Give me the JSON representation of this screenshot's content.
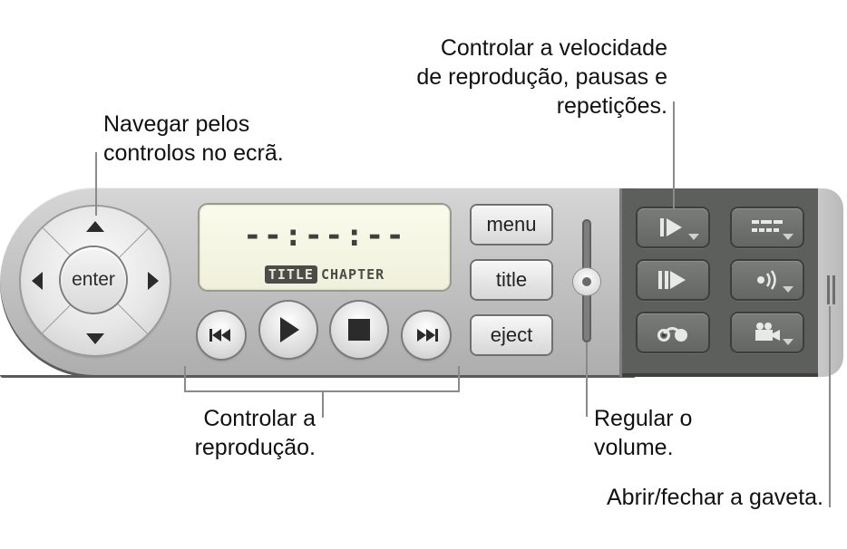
{
  "callouts": {
    "navigate": [
      "Navegar pelos",
      "controlos no ecrã."
    ],
    "speed": [
      "Controlar a velocidade",
      "de reprodução, pausas e",
      "repetições."
    ],
    "playback": [
      "Controlar a",
      "reprodução."
    ],
    "volume": [
      "Regular o",
      "volume."
    ],
    "drawer": [
      "Abrir/fechar a gaveta."
    ]
  },
  "controller": {
    "dpad": {
      "enter_label": "enter"
    },
    "lcd": {
      "time": "--:--:--",
      "tag_title": "TITLE",
      "tag_chapter": "CHAPTER"
    },
    "transport": [
      "previous",
      "play",
      "stop",
      "next"
    ],
    "buttons": {
      "menu": "menu",
      "title": "title",
      "eject": "eject"
    },
    "volume": {
      "level": 0.5
    }
  },
  "drawer": {
    "buttons": [
      "slow-motion",
      "subtitles",
      "step-frame",
      "audio",
      "return",
      "camera-angle"
    ]
  }
}
